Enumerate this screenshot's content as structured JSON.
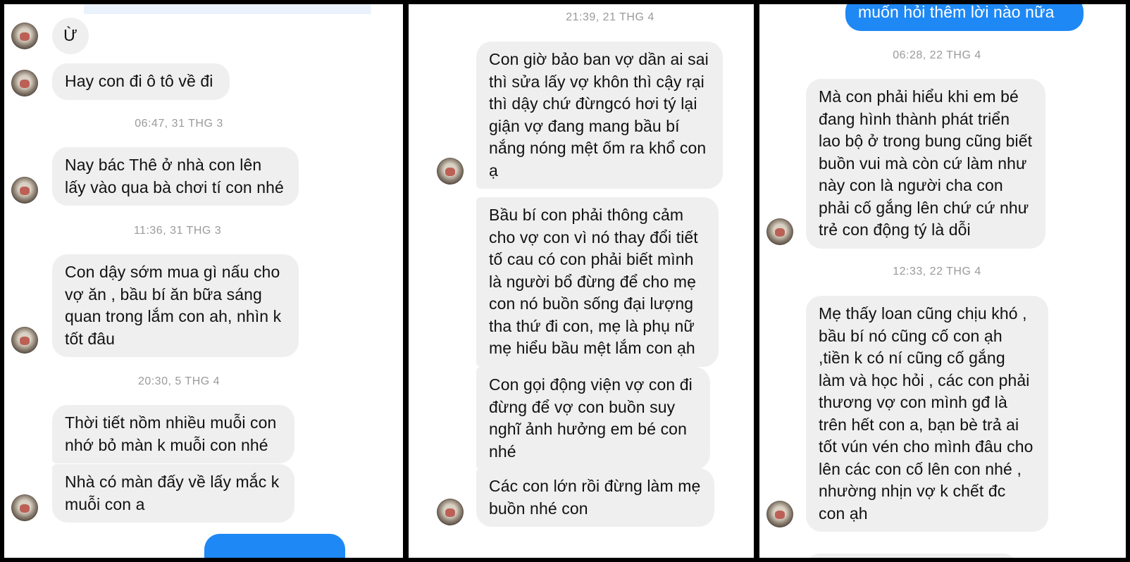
{
  "panel1": {
    "messages": [
      "Ừ",
      "Hay con đi ô tô về đi",
      "Nay bác Thê ở nhà con lên lấy vào qua bà chơi tí con nhé",
      "Con dậy sớm mua gì nấu cho vợ ăn , bầu bí ăn bữa sáng quan trong lắm con ah, nhìn k tốt đâu",
      "Thời tiết nồm nhiều muỗi con nhớ bỏ màn k muỗi con nhé",
      "Nhà có màn đấy về lấy mắc k muỗi con a"
    ],
    "timestamps": [
      "06:47, 31 THG 3",
      "11:36, 31 THG 3",
      "20:30, 5 THG 4"
    ]
  },
  "panel2": {
    "timestamps": [
      "21:39, 21 THG 4"
    ],
    "messages": [
      "Con giờ bảo ban vợ dần ai sai thì sửa lấy vợ khôn thì cậy rại thì dậy chứ đừngcó hơi tý lại giận vợ đang mang bầu bí nắng nóng mệt ốm ra khổ con ạ",
      "Bầu bí con phải thông cảm cho vợ con vì nó thay đổi tiết tố cau có con  phải biết mình là người bổ  đừng để cho mẹ con nó buồn sống đại lượng tha thứ đi con, mẹ là phụ nữ mẹ hiểu bầu mệt lắm con ạh",
      "Con gọi động viện vợ con đi đừng để vợ con buồn suy nghĩ ảnh hưởng em bé con nhé",
      "Các con lớn rồi đừng làm mẹ buồn nhé con"
    ]
  },
  "panel3": {
    "outgoing_partial": "muốn hỏi thêm lời nào nữa",
    "timestamps": [
      "06:28, 22 THG 4",
      "12:33, 22 THG 4"
    ],
    "messages": [
      "Mà con phải hiểu khi em bé đang hình thành phát triển lao bộ ở trong bung cũng biết buồn vui mà còn cứ làm như này con là người cha con phải cố gắng lên chứ cứ như trẻ con động tý là dỗi",
      "Mẹ thấy loan cũng chịu khó , bầu bí nó cũng cố con ạh ,tiền k có ní cũng cố gắng làm và học hỏi , các con phải thương vợ con mình gđ là trên hết con a, bạn bè trả ai tốt vún vén cho mình đâu cho lên các con cố lên con nhé , nhường nhịn vợ k chết đc con ạh"
    ]
  },
  "colors": {
    "incoming_bubble": "#efefef",
    "outgoing_bubble": "#1e88f5",
    "timestamp": "#9a9a9a"
  }
}
